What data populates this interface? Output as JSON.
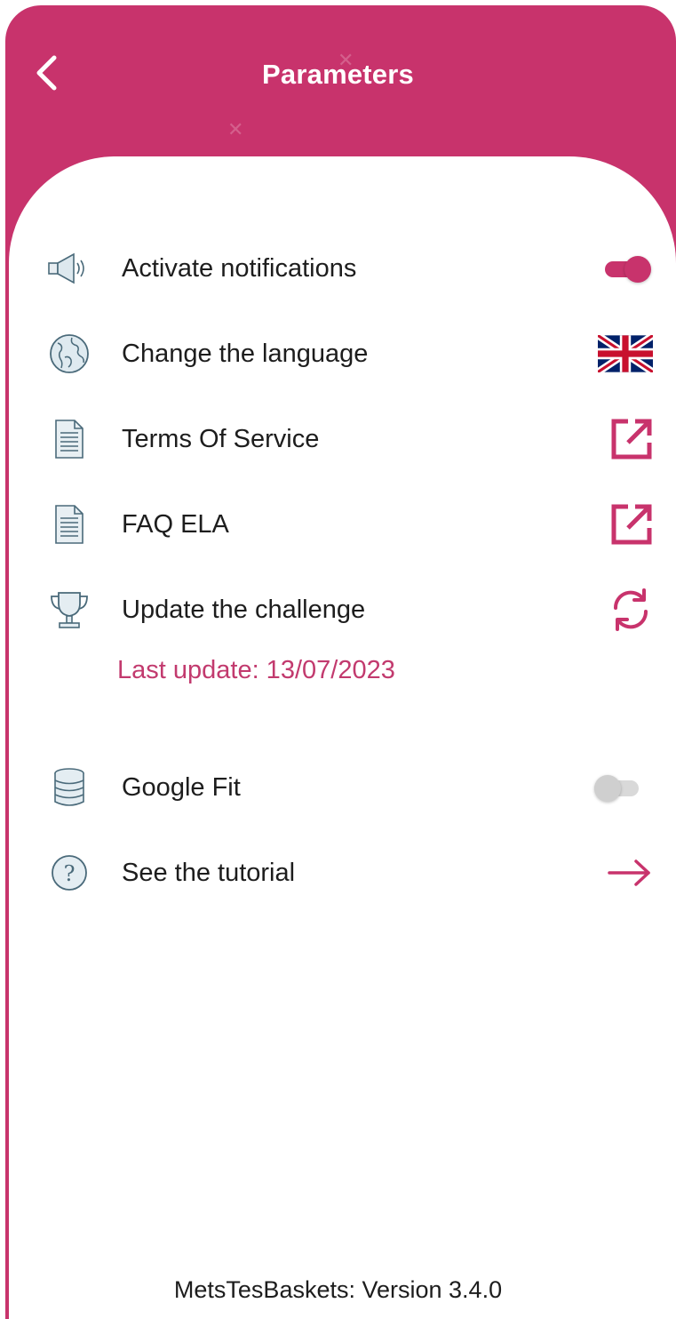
{
  "header": {
    "title": "Parameters",
    "back_icon": "chevron-left-icon"
  },
  "colors": {
    "brand": "#c8336c",
    "accent_text": "#c23a6e",
    "icon_stroke": "#4a6a7a"
  },
  "settings": {
    "items": [
      {
        "label": "Activate notifications",
        "icon": "megaphone-icon",
        "action": "toggle",
        "enabled": true
      },
      {
        "label": "Change the language",
        "icon": "globe-icon",
        "action": "uk-flag-icon"
      },
      {
        "label": "Terms Of Service",
        "icon": "document-icon",
        "action": "external-link-icon"
      },
      {
        "label": "FAQ ELA",
        "icon": "document-icon",
        "action": "external-link-icon"
      },
      {
        "label": "Update the challenge",
        "icon": "trophy-icon",
        "action": "refresh-icon"
      },
      {
        "label": "Google Fit",
        "icon": "database-icon",
        "action": "toggle",
        "enabled": false
      },
      {
        "label": "See the tutorial",
        "icon": "help-circle-icon",
        "action": "arrow-right-icon"
      }
    ],
    "last_update": "Last update: 13/07/2023"
  },
  "footer": {
    "version": "MetsTesBaskets: Version 3.4.0"
  }
}
